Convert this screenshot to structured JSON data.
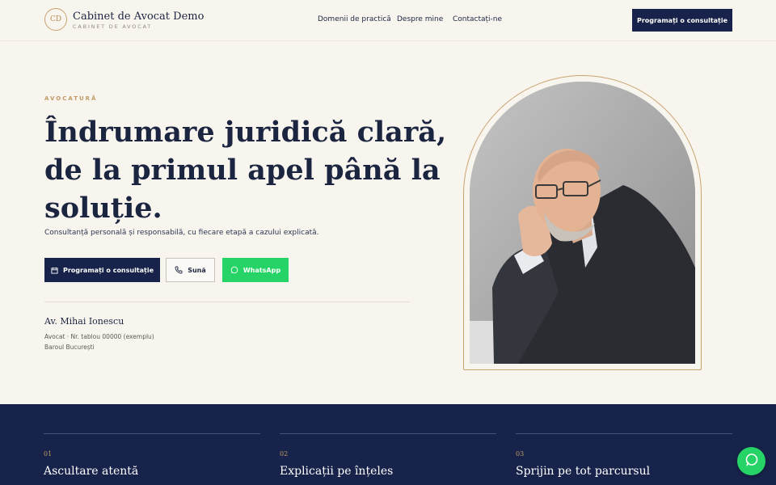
{
  "header": {
    "logo_initials": "CD",
    "brand_name": "Cabinet de Avocat Demo",
    "brand_sub": "CABINET DE AVOCAT",
    "nav": [
      "Domenii de practică",
      "Despre mine",
      "Contactați-ne"
    ],
    "cta_label": "Programați o consultație"
  },
  "hero": {
    "eyebrow": "AVOCATURĂ",
    "headline": [
      "Îndrumare juridică clară,",
      "de la primul apel până la",
      "soluție."
    ],
    "lead": "Consultanță personală și responsabilă, cu fiecare etapă a cazului explicată.",
    "buttons": {
      "primary": "Programați o consultație",
      "call": "Sună",
      "whatsapp": "WhatsApp"
    },
    "lawyer": {
      "name": "Av. Mihai Ionescu",
      "meta_line1": "Avocat · Nr. tablou 00000 (exemplu)",
      "meta_line2": "Baroul București"
    }
  },
  "features": [
    {
      "num": "01",
      "title": "Ascultare atentă"
    },
    {
      "num": "02",
      "title": "Explicații pe înțeles"
    },
    {
      "num": "03",
      "title": "Sprijin pe tot parcursul"
    }
  ],
  "colors": {
    "navy": "#17234a",
    "gold": "#c19a63",
    "cream": "#f8f5ef",
    "whatsapp": "#25d366"
  },
  "icons": [
    "calendar-icon",
    "phone-icon",
    "whatsapp-icon",
    "chat-icon"
  ]
}
